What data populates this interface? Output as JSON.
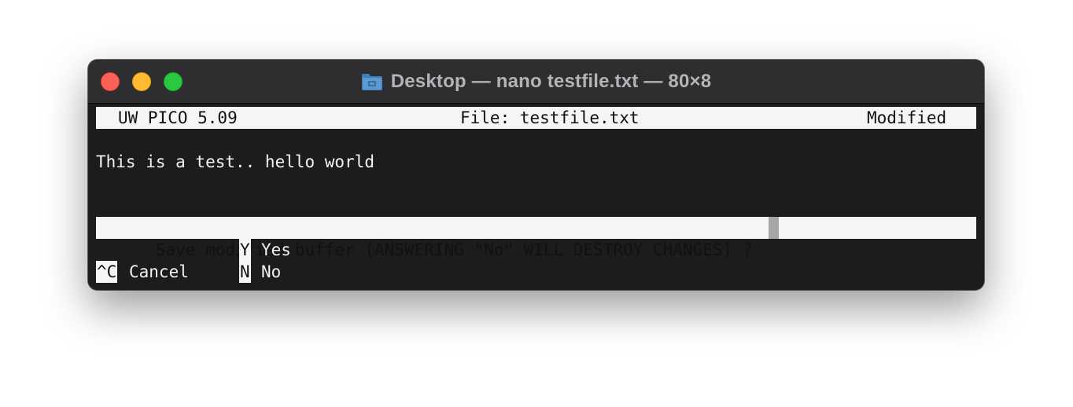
{
  "window": {
    "title": "Desktop — nano testfile.txt — 80×8",
    "title_icon": "folder-icon"
  },
  "nano": {
    "header": {
      "app_version": "UW PICO 5.09",
      "file_label": "File: testfile.txt",
      "status": "Modified"
    },
    "buffer_lines": [
      "",
      "This is a test.. hello world",
      "",
      ""
    ],
    "prompt": "Save modified buffer (ANSWERING \"No\" WILL DESTROY CHANGES) ? ",
    "shortcuts": {
      "cancel_key": "^C",
      "cancel_label": "Cancel",
      "yes_key": "Y",
      "yes_label": "Yes",
      "no_key": "N",
      "no_label": "No"
    }
  },
  "colors": {
    "terminal_bg": "#1c1c1e",
    "titlebar_bg": "#2e2d30",
    "inverse_bg": "#f5f5f5",
    "text": "#f2f2f2",
    "close": "#fe5f57",
    "minimize": "#febc2e",
    "maximize": "#28c840"
  }
}
